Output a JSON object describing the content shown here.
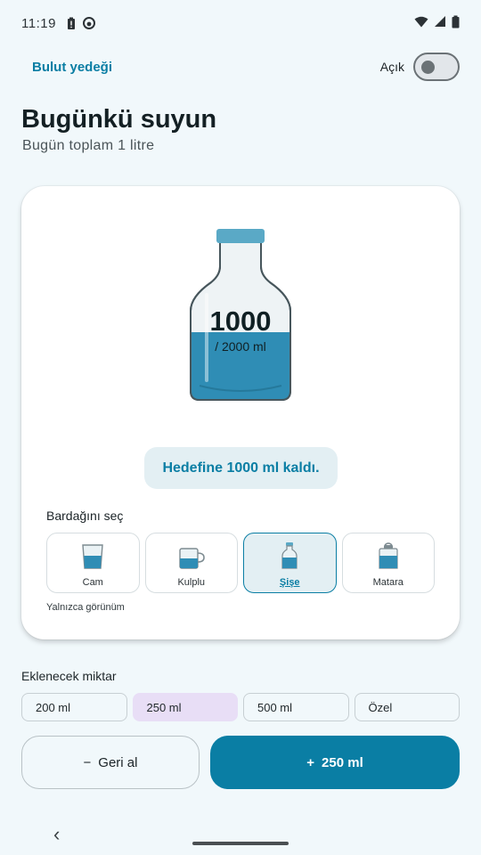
{
  "status_bar": {
    "time": "11:19",
    "icons": [
      "battery-alert-icon",
      "app-notification-icon",
      "wifi-icon",
      "signal-icon",
      "battery-icon"
    ]
  },
  "header": {
    "cloud_backup_label": "Bulut yedeği",
    "toggle_label": "Açık",
    "toggle_on": false
  },
  "page": {
    "title": "Bugünkü suyun",
    "subtitle": "Bugün toplam 1 litre"
  },
  "tracker": {
    "current_ml": "1000",
    "goal_text": "/ 2000 ml",
    "fill_fraction": 0.5,
    "remaining_text": "Hedefine 1000 ml kaldı.",
    "cup_section_title": "Bardağını seç",
    "cups": [
      {
        "label": "Cam",
        "icon": "glass-icon",
        "selected": false
      },
      {
        "label": "Kulplu",
        "icon": "mug-icon",
        "selected": false
      },
      {
        "label": "Şişe",
        "icon": "bottle-icon",
        "selected": true
      },
      {
        "label": "Matara",
        "icon": "flask-icon",
        "selected": false
      }
    ],
    "view_only_text": "Yalnızca görünüm"
  },
  "amount": {
    "title": "Eklenecek miktar",
    "options": [
      {
        "label": "200 ml",
        "selected": false
      },
      {
        "label": "250 ml",
        "selected": true
      },
      {
        "label": "500 ml",
        "selected": false
      },
      {
        "label": "Özel",
        "selected": false
      }
    ]
  },
  "actions": {
    "undo_sign": "−",
    "undo_label": "Geri al",
    "add_sign": "+",
    "add_label": "250 ml"
  },
  "colors": {
    "accent": "#0a7ea4",
    "water": "#2f8db5",
    "background": "#f1f8fb",
    "selected_chip": "#e8def6"
  }
}
